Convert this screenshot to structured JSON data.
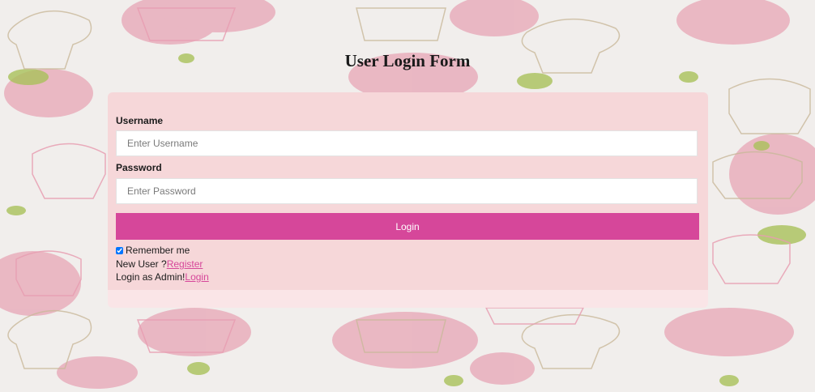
{
  "page": {
    "title": "User Login Form"
  },
  "form": {
    "username_label": "Username",
    "username_placeholder": "Enter Username",
    "username_value": "",
    "password_label": "Password",
    "password_placeholder": "Enter Password",
    "password_value": "",
    "login_button_label": "Login",
    "remember_label": "Remember me",
    "remember_checked": true,
    "new_user_text": "New User ?",
    "register_link": "Register",
    "admin_text": "Login as Admin!",
    "admin_login_link": "Login"
  },
  "colors": {
    "accent": "#d6479a",
    "card": "#f6d7d9",
    "background": "#f1eeec",
    "pattern_pink": "#e9a9bb",
    "pattern_green": "#a9c05a"
  },
  "icons": {
    "background": "cupcake-pattern"
  }
}
